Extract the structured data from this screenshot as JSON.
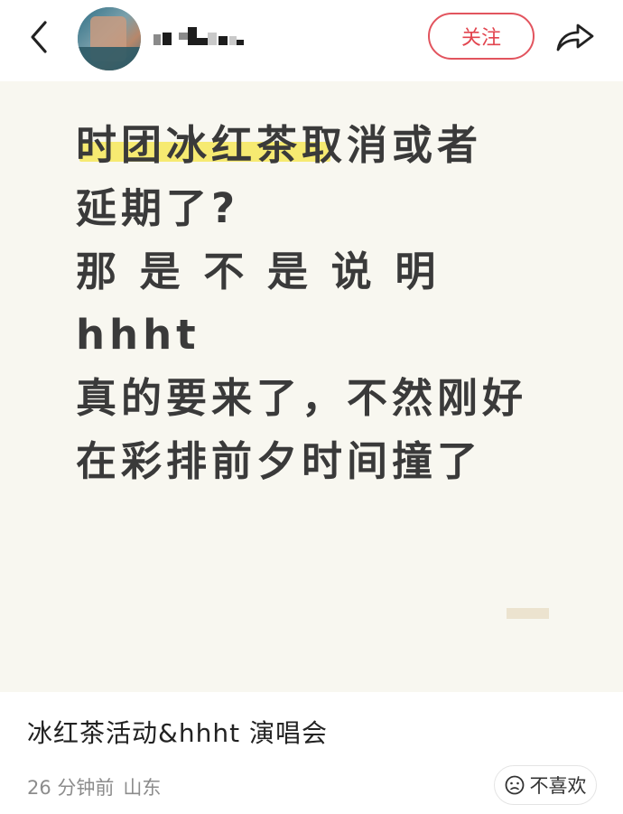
{
  "header": {
    "back_icon": "chevron-left-icon",
    "avatar_icon": "avatar-image",
    "username_censored": true,
    "follow_label": "关注",
    "share_icon": "share-icon"
  },
  "post": {
    "image_text": "时团冰红茶取消或者\n延期了?\n那 是 不 是 说 明 hhht\n真的要来了，不然刚好\n在彩排前夕时间撞了",
    "title": "冰红茶活动&hhht 演唱会",
    "time_ago": "26 分钟前",
    "location": "山东",
    "dislike_label": "不喜欢",
    "dislike_icon": "frown-face-icon"
  },
  "colors": {
    "accent": "#e2454f",
    "highlight": "#f6e85a",
    "image_bg": "#f8f7f0",
    "meta_text": "#8c8c8c"
  }
}
